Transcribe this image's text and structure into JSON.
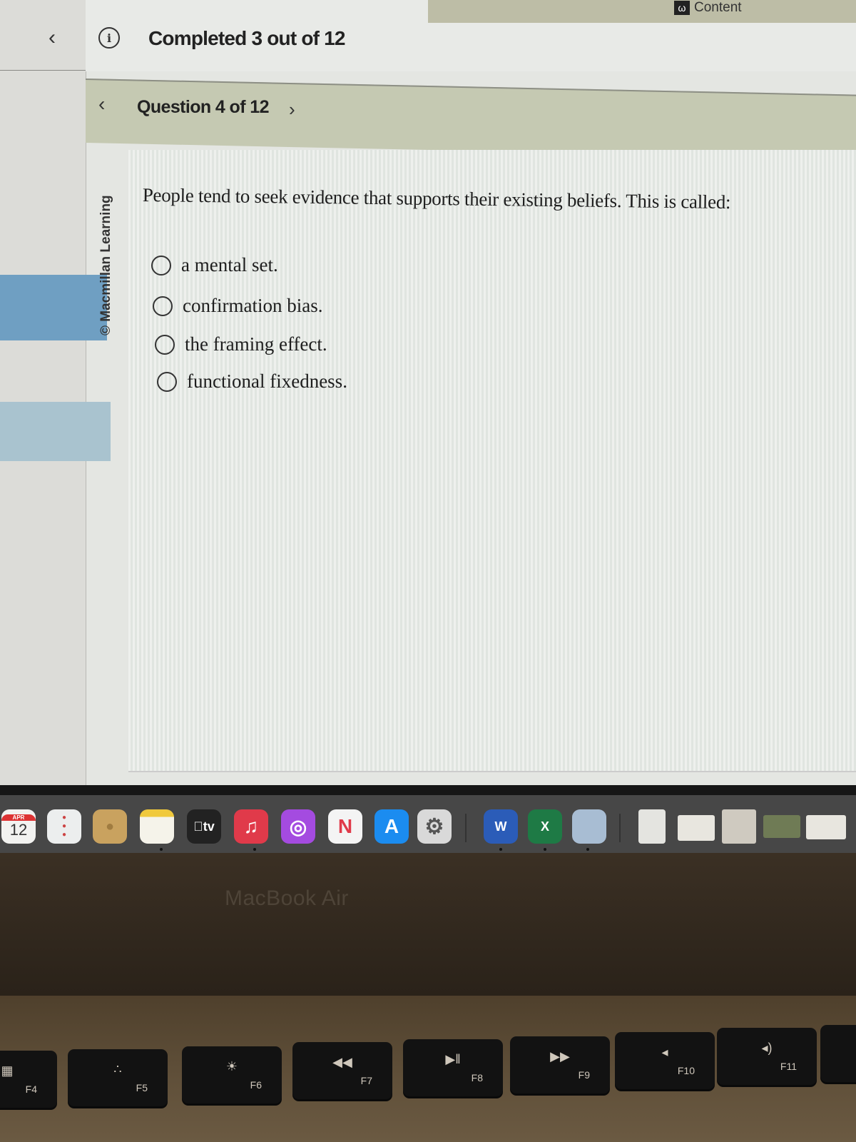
{
  "header": {
    "completed_text": "Completed 3 out of 12",
    "content_link": "Content",
    "back_icon": "chevron-left-icon",
    "info_icon": "info-icon",
    "info_glyph": "i",
    "content_glyph": "ω",
    "back_glyph": "‹"
  },
  "question_nav": {
    "label": "Question 4 of 12",
    "prev_glyph": "‹",
    "next_glyph": "›"
  },
  "watermark": "© Macmillan Learning",
  "question": {
    "text": "People tend to seek evidence that supports their existing beliefs. This is called:",
    "options": [
      {
        "label": "a mental set.",
        "selected": false
      },
      {
        "label": "confirmation bias.",
        "selected": false
      },
      {
        "label": "the framing effect.",
        "selected": false
      },
      {
        "label": "functional fixedness.",
        "selected": false
      }
    ]
  },
  "dock": {
    "apps": [
      {
        "name": "Calendar",
        "month": "APR",
        "day": "12"
      },
      {
        "name": "Reminders"
      },
      {
        "name": "Contacts"
      },
      {
        "name": "Notes"
      },
      {
        "name": "Apple TV",
        "label": "tv"
      },
      {
        "name": "Music",
        "label": "♫"
      },
      {
        "name": "Podcasts",
        "label": "◎"
      },
      {
        "name": "News",
        "label": "N"
      },
      {
        "name": "App Store",
        "label": "A"
      },
      {
        "name": "System Settings",
        "label": "⚙"
      },
      {
        "name": "Microsoft Word",
        "label": "W"
      },
      {
        "name": "Microsoft Excel",
        "label": "X"
      },
      {
        "name": "Preview"
      },
      {
        "name": "Document"
      },
      {
        "name": "Recent window 1"
      },
      {
        "name": "Recent window 2"
      },
      {
        "name": "Recent window 3"
      },
      {
        "name": "Recent window 4"
      }
    ]
  },
  "hardware": {
    "model": "MacBook Air",
    "keys": [
      {
        "f": "F4",
        "glyph": "▦"
      },
      {
        "f": "F5",
        "glyph": "∴"
      },
      {
        "f": "F6",
        "glyph": "☀"
      },
      {
        "f": "F7",
        "glyph": "◀◀"
      },
      {
        "f": "F8",
        "glyph": "▶‖"
      },
      {
        "f": "F9",
        "glyph": "▶▶"
      },
      {
        "f": "F10",
        "glyph": "◂"
      },
      {
        "f": "F11",
        "glyph": "◂)"
      }
    ]
  }
}
